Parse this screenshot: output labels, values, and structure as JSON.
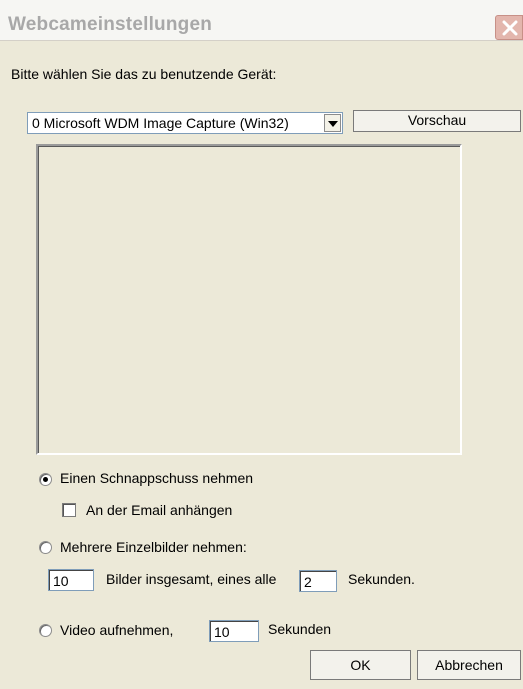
{
  "window": {
    "title": "Webcameinstellungen"
  },
  "prompt_label": "Bitte wählen Sie das zu benutzende Gerät:",
  "device_select": {
    "selected": "0 Microsoft WDM Image Capture (Win32)"
  },
  "preview_button_label": "Vorschau",
  "options": {
    "snapshot_label": "Einen Schnappschuss nehmen",
    "attach_email_label": "An der Email anhängen",
    "multiple_label": "Mehrere Einzelbilder nehmen:",
    "images_total_value": "10",
    "images_total_text": "Bilder insgesamt, eines alle",
    "interval_value": "2",
    "interval_unit": "Sekunden.",
    "video_label": "Video aufnehmen,",
    "video_seconds_value": "10",
    "video_unit": "Sekunden"
  },
  "footer": {
    "ok_label": "OK",
    "cancel_label": "Abbrechen"
  }
}
